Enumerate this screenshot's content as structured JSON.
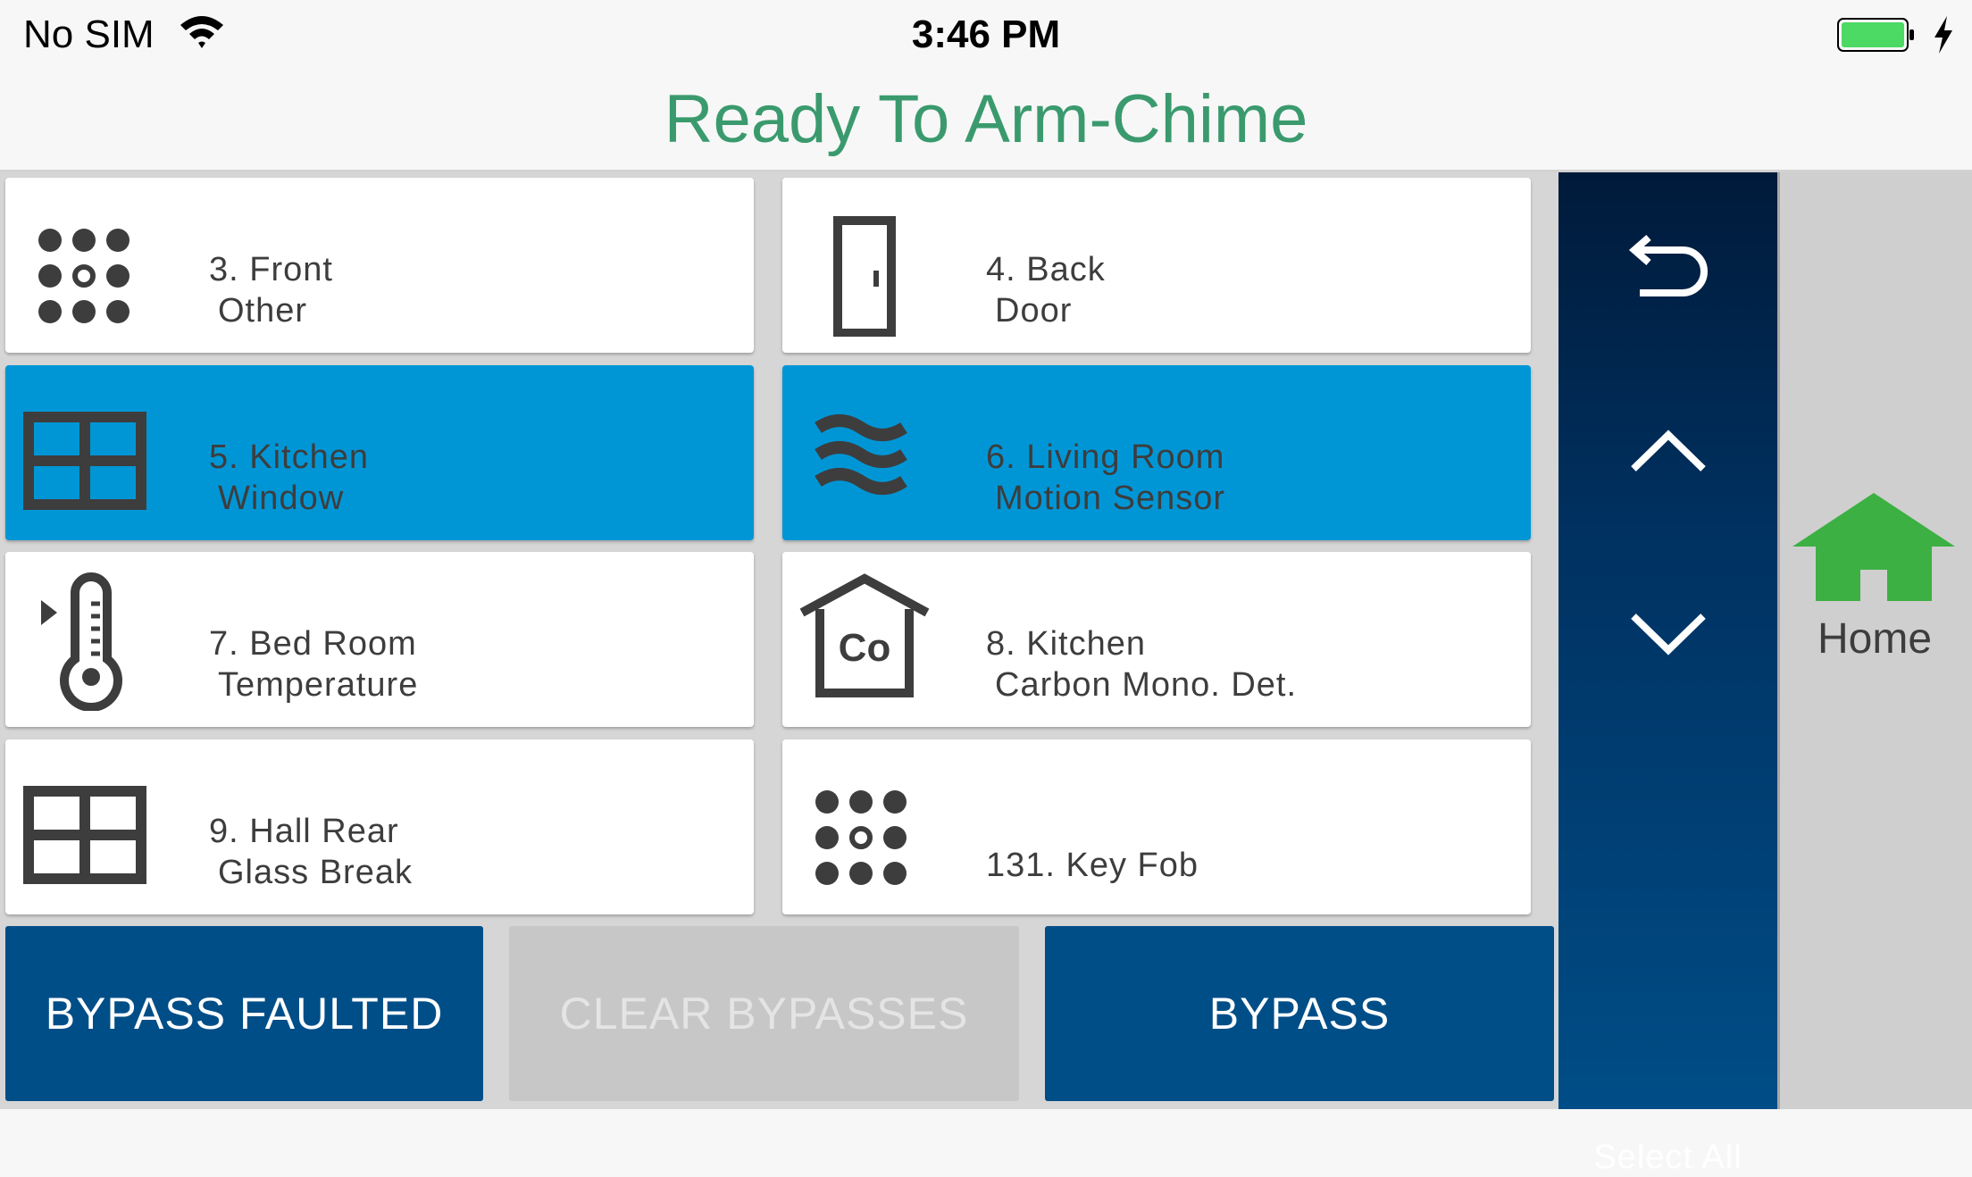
{
  "status_bar": {
    "carrier": "No SIM",
    "time": "3:46 PM",
    "wifi_icon": "wifi-icon",
    "battery_icon": "battery-charging-icon"
  },
  "header": {
    "title": "Ready To Arm-Chime",
    "title_color": "#3a9a6e"
  },
  "zones": [
    {
      "line1": "3. Front",
      "line2": "Other",
      "icon": "keypad-icon",
      "selected": false
    },
    {
      "line1": "4. Back",
      "line2": "Door",
      "icon": "door-icon",
      "selected": false
    },
    {
      "line1": "5. Kitchen",
      "line2": "Window",
      "icon": "window-icon",
      "selected": true
    },
    {
      "line1": "6. Living Room",
      "line2": "Motion Sensor",
      "icon": "motion-icon",
      "selected": true
    },
    {
      "line1": "7. Bed Room",
      "line2": "Temperature",
      "icon": "thermometer-icon",
      "selected": false
    },
    {
      "line1": "8. Kitchen",
      "line2": "Carbon Mono. Det.",
      "icon": "co-detector-icon",
      "selected": false
    },
    {
      "line1": "9. Hall Rear",
      "line2": "Glass Break",
      "icon": "window-icon",
      "selected": false
    },
    {
      "line1": "131. Key Fob",
      "line2": "",
      "icon": "keypad-icon",
      "selected": false
    }
  ],
  "co_label": "Co",
  "actions": {
    "bypass_faulted": "BYPASS FAULTED",
    "clear_bypasses": "CLEAR BYPASSES",
    "bypass": "BYPASS"
  },
  "nav": {
    "back_icon": "back-arrow-icon",
    "up_icon": "chevron-up-icon",
    "down_icon": "chevron-down-icon",
    "select_all": "Select All"
  },
  "home": {
    "label": "Home",
    "icon": "home-icon"
  },
  "colors": {
    "selected_tile": "#0096d6",
    "action_primary": "#004e87",
    "action_disabled": "#c7c7c7",
    "home_green": "#3cb043",
    "battery_green": "#4cd964"
  }
}
